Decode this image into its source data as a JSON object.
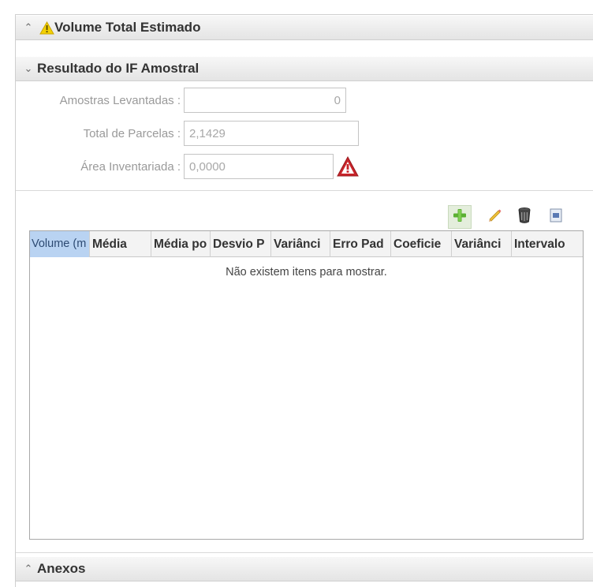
{
  "panels": {
    "volume": {
      "title": "Volume Total Estimado",
      "collapsed": true
    },
    "resultado": {
      "title": "Resultado do IF Amostral",
      "expanded": true
    },
    "anexos": {
      "title": "Anexos",
      "collapsed": true
    }
  },
  "form": {
    "amostras": {
      "label": "Amostras Levantadas :",
      "value": "0"
    },
    "parcelas": {
      "label": "Total de Parcelas :",
      "value": "2,1429"
    },
    "area": {
      "label": "Área Inventariada :",
      "value": "0,0000"
    }
  },
  "toolbar": {
    "icons": [
      "add-icon",
      "edit-icon",
      "delete-icon",
      "export-icon"
    ]
  },
  "grid": {
    "columns": [
      "Volume (m",
      "Média",
      "Média po",
      "Desvio P",
      "Variânci",
      "Erro Pad",
      "Coeficie",
      "Variânci",
      "Intervalo"
    ],
    "empty_text": "Não existem itens para mostrar."
  },
  "colors": {
    "header_bg": "#e9e9e9",
    "selected_col": "#b9d3f2",
    "warning_yellow": "#f3d000",
    "alert_red": "#c8242a",
    "add_green": "#5bb033"
  }
}
